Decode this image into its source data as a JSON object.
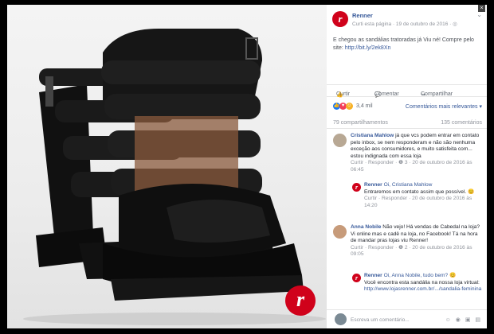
{
  "page": {
    "name": "Renner",
    "post_meta": "Curti esta página · 19 de outubro de 2016 · ",
    "post_text": "E chegou as sandálias tratoradas já Viu né! Compre pelo site: ",
    "post_link": "http://bit.ly/2ek8Xn",
    "brand_color": "#d0021b",
    "logo_letter": "r"
  },
  "actions": {
    "like": "Curtir",
    "comment": "Comentar",
    "share": "Compartilhar"
  },
  "reactions": {
    "count": "3,4 mil",
    "filter": "Comentários mais relevantes ▾"
  },
  "counts": {
    "shares": "79 compartilhamentos",
    "comments": "135 comentários"
  },
  "comments": [
    {
      "author": "Cristiana Mahlow",
      "text": " já que vcs podem entrar em contato pelo inbox, se nem responderam e não são nenhuma exceção aos consumidores, e muito satisfeita com... estou indignada com essa loja",
      "meta": "Curtir · Responder · ❶ 3 · 20 de outubro de 2016 às 06:45"
    },
    {
      "author": "Renner",
      "mention": "Oi, Cristiana Mahlow",
      "text": "Entraremos em contato assim que possível. 😊",
      "meta": "Curtir · Responder · 20 de outubro de 2016 às 14:20"
    },
    {
      "author": "Anna Nobile",
      "text": " Não vejo! Há vendas de Cabedal na loja? Vi online mas e cadê na loja, no Facebook! Tá na hora de mandar pras lojas viu Renner!",
      "meta": "Curtir · Responder · ❶ 2 · 20 de outubro de 2016 às 09:05"
    },
    {
      "author": "Renner",
      "mention": "Oi, Anna Nobile, tudo bem? 😊",
      "text": "Você encontra esta sandália na nossa loja virtual: ",
      "link": "http://www.lojasrenner.com.br/.../sandalia-feminina",
      "meta": ""
    }
  ],
  "footer": {
    "placeholder": "Escreva um comentário...",
    "icons": "☺ ◉ ▣ ▤"
  }
}
